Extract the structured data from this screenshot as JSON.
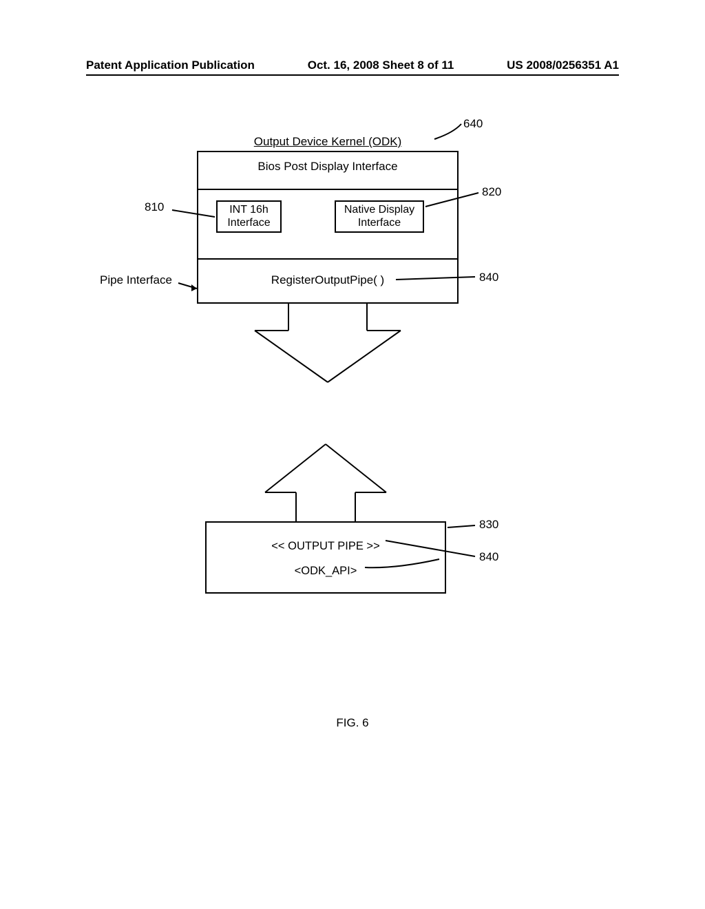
{
  "header": {
    "left": "Patent Application Publication",
    "center": "Oct. 16, 2008   Sheet 8 of 11",
    "right": "US 2008/0256351 A1"
  },
  "odk": {
    "title": "Output Device Kernel (ODK)",
    "bpdi": "Bios Post Display Interface",
    "int16": "INT 16h Interface",
    "native": "Native Display Interface",
    "rop": "RegisterOutputPipe( )"
  },
  "labels": {
    "n640": "640",
    "n810": "810",
    "n820": "820",
    "n830": "830",
    "n840": "840",
    "pipe": "Pipe Interface"
  },
  "output_pipe": {
    "line1": "<< OUTPUT PIPE >>",
    "line2": "<ODK_API>"
  },
  "figure": "FIG. 6"
}
